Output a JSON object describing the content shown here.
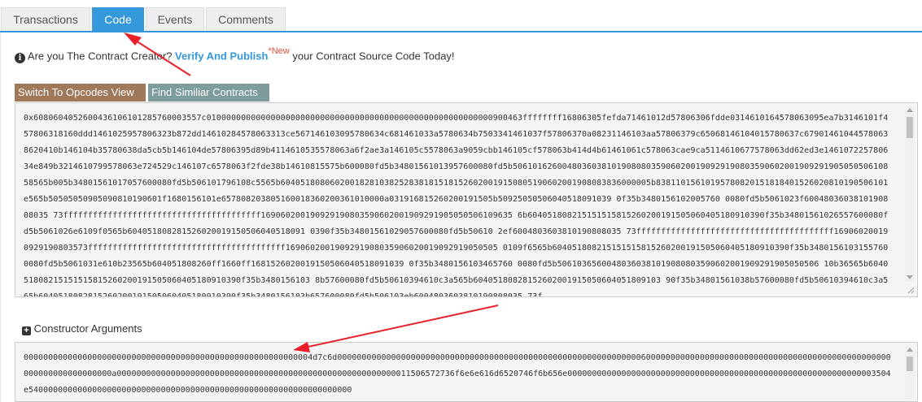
{
  "tabs": [
    {
      "label": "Transactions",
      "active": false
    },
    {
      "label": "Code",
      "active": true
    },
    {
      "label": "Events",
      "active": false
    },
    {
      "label": "Comments",
      "active": false
    }
  ],
  "info": {
    "prefix": "Are you The Contract Creator?",
    "link": "Verify And Publish",
    "badge": "*New",
    "suffix": "your Contract Source Code Today!"
  },
  "buttons": {
    "opcodes": "Switch To Opcodes View",
    "similar": "Find Similiar Contracts"
  },
  "bytecode": "0x6080604052600436106101285760003557c0100000000000000000000000000000000000000000000000000000000900463ffffffff16806305fefda71461012d57806306fdde0314610164578063095ea7b3146101f457806318160ddd1461025957806323b872dd14610284578063313ce567146103095780634c681461033a5780634b7503341461037f57806370a08231146103aa57806379c65068146104015780637c679014610445780638620410b146104b35780638da5cb5b146104de57806395d89b4114610535578063a6f2ae3a146105c5578063a9059cbb146105cf578063b414d4b61461061c578063cae9ca5114610677578063dd62ed3e146107225780634e849b3214610799578063e724529c146107c6578063f2fde38b14610815575b600080fd5b34801561013957600080fd5b506101626004803603810190808035906020019092919080359060200190929190505050610858565b005b34801561017057600080fd5b506101796108c5565b604051808060200182810382528381815181526020019150805190602001908083836000005b83811015610195780820151818401526020810190506101e565b50505050905090810190601f1680156101e657808203805160018360200361010000a031916815260200191505b50925050506040518091039 0f35b3480156102005760 0080fd5b5061023f6004803603810190808035 73ffffffffffffffffffffffffffffffffffffffff169060200190929190803590602001909291905050506109635 6b604051808215151515815260200191505060405180910390f35b34801561026557600080fd5b5061026e6109f0565b604051808281526020019150506040518091 0390f35b34801561029057600080fd5b50610 2ef6004803603810190808035 73ffffffffffffffffffffffffffffffffffffffff169060200190929190803573ffffffffffffffffffffffffffffffffffffffff1690602001909291908035906020019092919050505 0109f6565b604051808215151515815260200191505060405180910390f35b34801561031557600080fd5b5061031e610b23565b604051808260ff1660ff1681526020019150506040518091039 0f35b3480156103465760 0080fd5b50610365600480360381019080803590602001909291905050506 10b36565b604051808215151515815260200191505060405180910390f35b3480156103 8b57600080fd5b50610394610c3a565b60405180828152602001915050604051809103 90f35b34801561038b57600080fd5b50610394610c3a565b6040518082815260200191505060405180910390f35b3480156103b657600080fd5b506103eb6004803603810190808035 73f",
  "constructor": {
    "label": "Constructor Arguments",
    "value": "00000000000000000000000000000000000000000000000000000000004d7c6d00000000000000000000000000000000000000000000000000000000000000600000000000000000000000000000000000000000000000000000000000000000000a000000000000000000000000000000000000000000000000000000000011506572736f6e6e616d6520746f6b656e000000000000000000000000000000000000000000000000000000000000003504e540000000000000000000000000000000000000000000000000000000000000000"
  }
}
